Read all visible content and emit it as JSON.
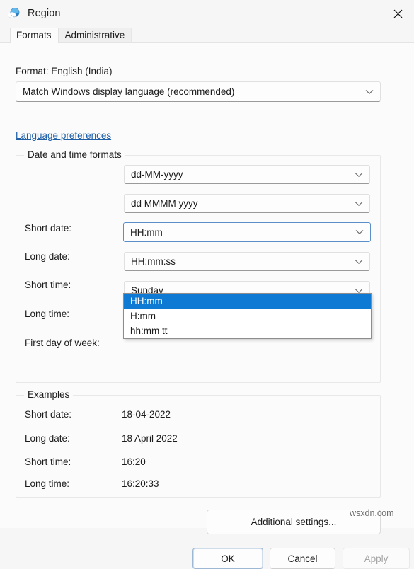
{
  "window": {
    "title": "Region",
    "icon": "region-globe-icon",
    "close_label": "✕"
  },
  "tabs": [
    {
      "label": "Formats",
      "active": true
    },
    {
      "label": "Administrative",
      "active": false
    }
  ],
  "format_section": {
    "label": "Format: English (India)",
    "combo_value": "Match Windows display language (recommended)"
  },
  "language_link": "Language preferences",
  "date_time_group": {
    "title": "Date and time formats",
    "rows": [
      {
        "label": "Short date:",
        "value": "dd-MM-yyyy"
      },
      {
        "label": "Long date:",
        "value": "dd MMMM yyyy"
      },
      {
        "label": "Short time:",
        "value": "HH:mm"
      },
      {
        "label": "Long time:",
        "value": "HH:mm:ss"
      },
      {
        "label": "First day of week:",
        "value": "Sunday"
      }
    ]
  },
  "short_time_dropdown": {
    "open": true,
    "options": [
      {
        "label": "HH:mm",
        "selected": true
      },
      {
        "label": "H:mm",
        "selected": false
      },
      {
        "label": "hh:mm tt",
        "selected": false
      }
    ],
    "highlight_color": "#0f7ad4"
  },
  "examples_group": {
    "title": "Examples",
    "rows": [
      {
        "label": "Short date:",
        "value": "18-04-2022"
      },
      {
        "label": "Long date:",
        "value": "18 April 2022"
      },
      {
        "label": "Short time:",
        "value": "16:20"
      },
      {
        "label": "Long time:",
        "value": "16:20:33"
      }
    ]
  },
  "buttons": {
    "additional_settings": "Additional settings...",
    "ok": "OK",
    "cancel": "Cancel",
    "apply": "Apply"
  },
  "watermark": "wsxdn.com",
  "colors": {
    "accent": "#0f7ad4",
    "link": "#1f5fa8",
    "dialog_bg": "#fbfbfb",
    "titlebar_bg": "#f6f6f6"
  }
}
